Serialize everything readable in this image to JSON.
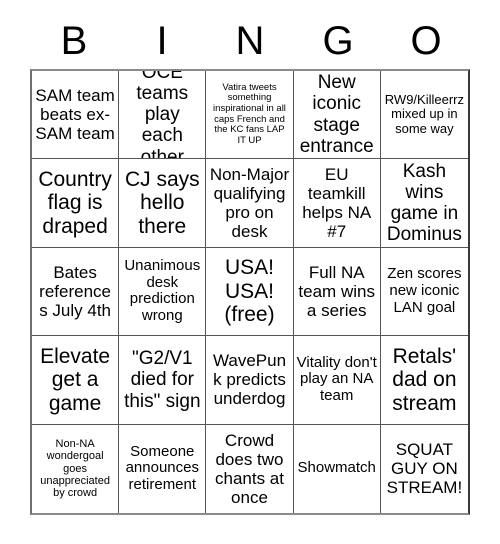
{
  "header": {
    "letters": [
      "B",
      "I",
      "N",
      "G",
      "O"
    ]
  },
  "grid": {
    "rows": 5,
    "columns": 5,
    "free_space_index": 12,
    "cells": [
      {
        "text": "SAM team beats ex-SAM team",
        "size": "l"
      },
      {
        "text": "OCE teams play each other",
        "size": "xl"
      },
      {
        "text": "Vatira tweets something inspirational in all caps French and the KC fans LAP IT UP",
        "size": "xxs"
      },
      {
        "text": "New iconic stage entrance",
        "size": "xl"
      },
      {
        "text": "RW9/Killeerrz mixed up in some way",
        "size": "s"
      },
      {
        "text": "Country flag is draped",
        "size": "xxl"
      },
      {
        "text": "CJ says hello there",
        "size": "xxl"
      },
      {
        "text": "Non-Major qualifying pro on desk",
        "size": "l"
      },
      {
        "text": "EU teamkill helps NA #7",
        "size": "l"
      },
      {
        "text": "Kash wins game in Dominus",
        "size": "xl"
      },
      {
        "text": "Bates references July 4th",
        "size": "l"
      },
      {
        "text": "Unanimous desk prediction wrong",
        "size": "m"
      },
      {
        "text": "USA! USA! (free)",
        "size": "xxl"
      },
      {
        "text": "Full NA team wins a series",
        "size": "l"
      },
      {
        "text": "Zen scores new iconic LAN goal",
        "size": "m"
      },
      {
        "text": "Elevate get a game",
        "size": "xxl"
      },
      {
        "text": "\"G2/V1 died for this\" sign",
        "size": "xl"
      },
      {
        "text": "WavePunk predicts underdog",
        "size": "l"
      },
      {
        "text": "Vitality don't play an NA team",
        "size": "m"
      },
      {
        "text": "Retals' dad on stream",
        "size": "xxl"
      },
      {
        "text": "Non-NA wondergoal goes unappreciated by crowd",
        "size": "xs"
      },
      {
        "text": "Someone announces retirement",
        "size": "m"
      },
      {
        "text": "Crowd does two chants at once",
        "size": "l"
      },
      {
        "text": "Showmatch",
        "size": "m"
      },
      {
        "text": "SQUAT GUY ON STREAM!",
        "size": "l"
      }
    ]
  }
}
